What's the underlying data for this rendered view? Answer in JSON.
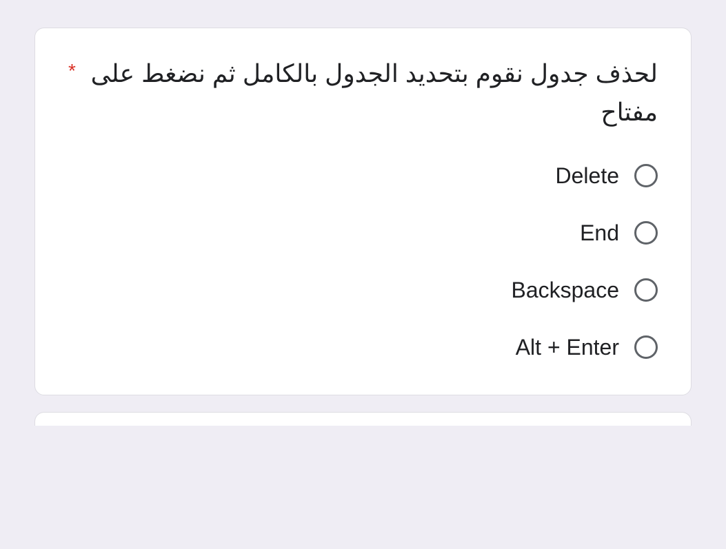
{
  "question": {
    "required_marker": "*",
    "text": "لحذف جدول نقوم بتحديد الجدول بالكامل ثم نضغط على مفتاح",
    "options": [
      {
        "label": "Delete"
      },
      {
        "label": "End"
      },
      {
        "label": "Backspace"
      },
      {
        "label": "Alt + Enter"
      }
    ]
  }
}
